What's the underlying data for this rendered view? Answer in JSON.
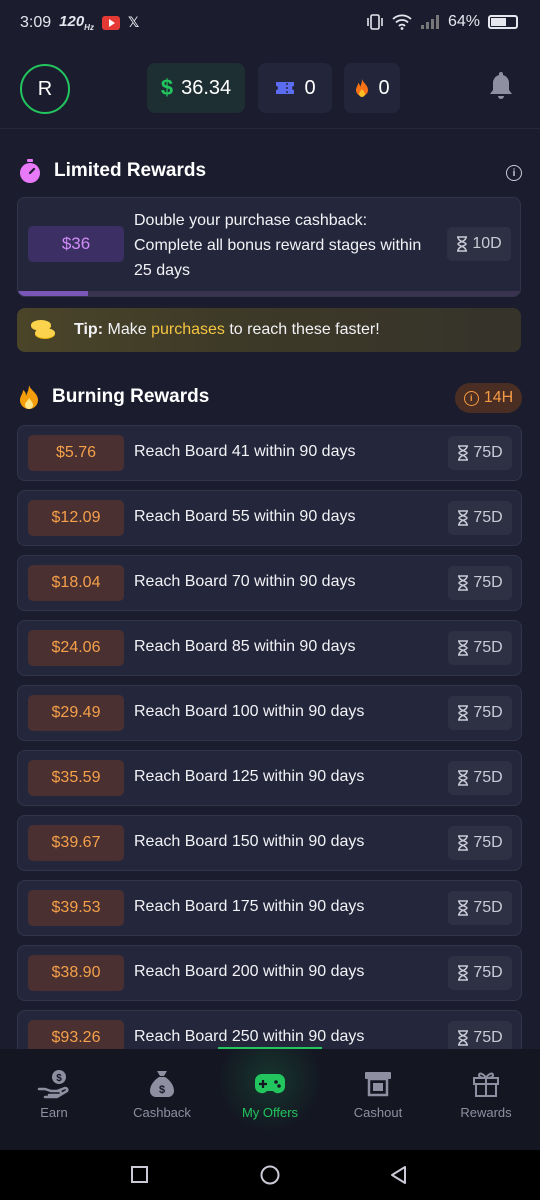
{
  "status_bar": {
    "time": "3:09",
    "refresh": "120",
    "battery": "64%",
    "battery_level": 0.64
  },
  "header": {
    "avatar_initial": "R",
    "cash": "36.34",
    "tickets": "0",
    "streak": "0"
  },
  "limited": {
    "title": "Limited Rewards",
    "card": {
      "amount": "$36",
      "description": "Double your purchase cashback: Complete all bonus reward stages within 25 days",
      "timer": "10D",
      "progress": 0.14
    }
  },
  "tip": {
    "label": "Tip:",
    "text_before": "Make ",
    "highlight": "purchases",
    "text_after": " to reach these faster!"
  },
  "burning": {
    "title": "Burning Rewards",
    "badge": "14H",
    "items": [
      {
        "amount": "$5.76",
        "text": "Reach Board 41 within 90 days",
        "timer": "75D"
      },
      {
        "amount": "$12.09",
        "text": "Reach Board 55 within 90 days",
        "timer": "75D"
      },
      {
        "amount": "$18.04",
        "text": "Reach Board 70 within 90 days",
        "timer": "75D"
      },
      {
        "amount": "$24.06",
        "text": "Reach Board 85 within 90 days",
        "timer": "75D"
      },
      {
        "amount": "$29.49",
        "text": "Reach Board 100 within 90 days",
        "timer": "75D"
      },
      {
        "amount": "$35.59",
        "text": "Reach Board 125 within 90 days",
        "timer": "75D"
      },
      {
        "amount": "$39.67",
        "text": "Reach Board 150 within 90 days",
        "timer": "75D"
      },
      {
        "amount": "$39.53",
        "text": "Reach Board 175 within 90 days",
        "timer": "75D"
      },
      {
        "amount": "$38.90",
        "text": "Reach Board 200 within 90 days",
        "timer": "75D"
      },
      {
        "amount": "$93.26",
        "text": "Reach Board 250 within 90 days",
        "timer": "75D"
      }
    ]
  },
  "nav": {
    "items": [
      {
        "label": "Earn",
        "icon": "earn-hand-coin-icon"
      },
      {
        "label": "Cashback",
        "icon": "money-bag-icon"
      },
      {
        "label": "My Offers",
        "icon": "gamepad-icon"
      },
      {
        "label": "Cashout",
        "icon": "cashout-icon"
      },
      {
        "label": "Rewards",
        "icon": "gift-icon"
      }
    ],
    "active": "My Offers"
  },
  "colors": {
    "accent_green": "#22c55e",
    "orange": "#f5a04a",
    "purple": "#d08cf7",
    "gold": "#f5c542"
  }
}
